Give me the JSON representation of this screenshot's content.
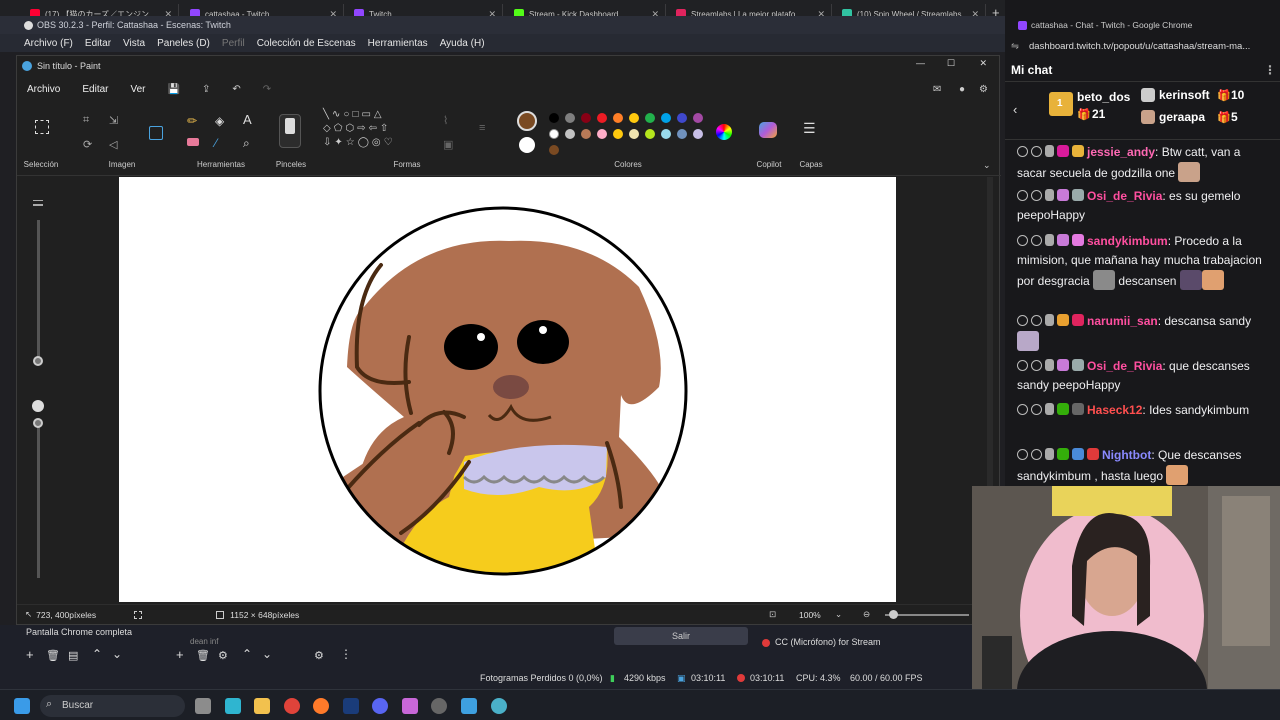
{
  "browser": {
    "tabs": [
      {
        "title": "(17) 【猫のカーズ／エンジン",
        "color": "#ff0033"
      },
      {
        "title": "cattashaa - Twitch",
        "color": "#9146ff"
      },
      {
        "title": "Twitch",
        "color": "#9146ff"
      },
      {
        "title": "Stream - Kick Dashboard",
        "color": "#53fc18"
      },
      {
        "title": "Streamlabs | La mejor platafo",
        "color": "#e0245e"
      },
      {
        "title": "(10) Spin Wheel / Streamlabs",
        "color": "#31c3a2"
      }
    ]
  },
  "obs": {
    "title": "OBS 30.2.3 - Perfil: Cattashaa - Escenas: Twitch",
    "menu": [
      "Archivo (F)",
      "Editar",
      "Vista",
      "Paneles (D)",
      "Perfil",
      "Colección de Escenas",
      "Herramientas",
      "Ayuda (H)"
    ],
    "scene_item": "Pantalla Chrome completa",
    "source_item": "dean inf",
    "exit_label": "Salir",
    "mic_label": "CC (Micrófono) for Stream",
    "status": {
      "dropped": "Fotogramas Perdidos 0 (0,0%)",
      "bitrate": "4290 kbps",
      "stream_time": "03:10:11",
      "rec_time": "03:10:11",
      "cpu": "CPU: 4.3%",
      "fps": "60.00 / 60.00 FPS"
    }
  },
  "paint": {
    "title": "Sin título - Paint",
    "menu": [
      "Archivo",
      "Editar",
      "Ver"
    ],
    "groups": {
      "selection": "Selección",
      "image": "Imagen",
      "tools": "Herramientas",
      "brushes": "Pinceles",
      "shapes": "Formas",
      "colors": "Colores",
      "copilot": "Copilot",
      "layers": "Capas"
    },
    "primary_color": "#7a4a22",
    "secondary_color": "#ffffff",
    "palette": [
      "#000000",
      "#7f7f7f",
      "#880015",
      "#ed1c24",
      "#ff7f27",
      "#ffc90e",
      "#22b14c",
      "#00a2e8",
      "#3f48cc",
      "#a349a4",
      "#ffffff",
      "#c3c3c3",
      "#b97a57",
      "#ffaec9",
      "#ffc90e",
      "#efe4b0",
      "#b5e61d",
      "#99d9ea",
      "#7092be",
      "#c8bfe7",
      "#7a4a22"
    ],
    "status": {
      "cursor": "723, 400píxeles",
      "size": "1152 × 648píxeles",
      "zoom": "100%"
    }
  },
  "chat": {
    "window_title": "cattashaa - Chat - Twitch - Google Chrome",
    "url": "dashboard.twitch.tv/popout/u/cattashaa/stream-ma...",
    "header": "Mi chat",
    "leaderboard": [
      {
        "rank": "1",
        "user": "beto_dos",
        "value": "21"
      },
      {
        "user": "kerinsoft",
        "value": "10"
      },
      {
        "user": "geraapa",
        "value": "5"
      }
    ],
    "messages": [
      {
        "user": "jessie_andy",
        "color": "#ff69b4",
        "text": "Btw catt, van a sacar secuela de godzilla one"
      },
      {
        "user": "Osi_de_Rivia",
        "color": "#ff4fa0",
        "text": "es su gemelo peepoHappy"
      },
      {
        "user": "sandykimbum",
        "color": "#ff4fa0",
        "text": "Procedo a la mimision, que mañana hay mucha trabajacion por desgracia",
        "text2": "descansen"
      },
      {
        "user": "narumii_san",
        "color": "#ff4fa0",
        "text": "descansa sandy"
      },
      {
        "user": "Osi_de_Rivia",
        "color": "#ff4fa0",
        "text": "que descanses sandy peepoHappy"
      },
      {
        "user": "Haseck12",
        "color": "#ff4f4f",
        "text": "Ides sandykimbum"
      },
      {
        "user": "Nightbot",
        "color": "#8a8aff",
        "text": "Que descanses sandykimbum , hasta luego"
      }
    ]
  },
  "taskbar": {
    "search_placeholder": "Buscar"
  }
}
